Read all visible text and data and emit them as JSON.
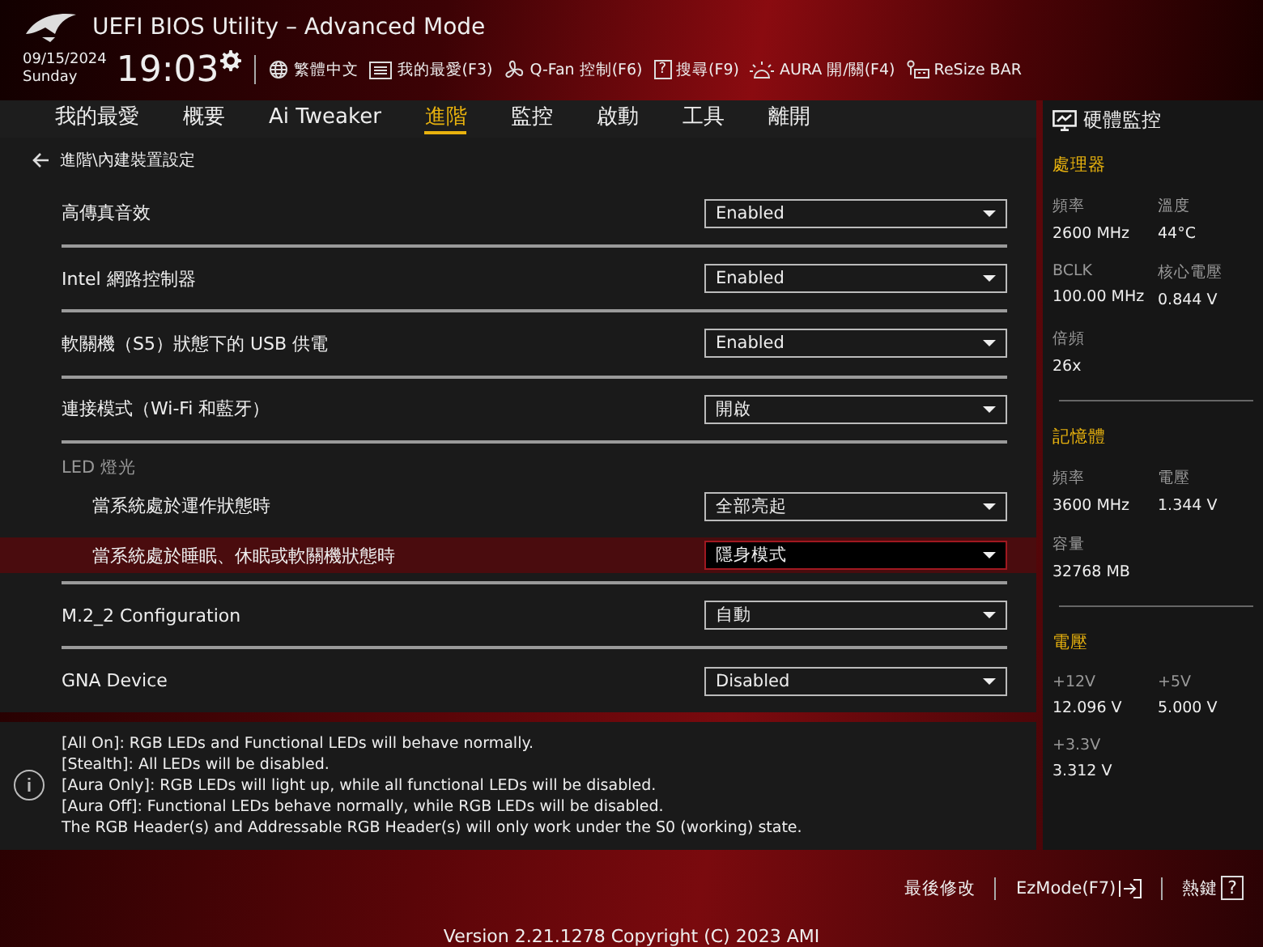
{
  "header": {
    "title": "UEFI BIOS Utility – Advanced Mode",
    "date": "09/15/2024",
    "day": "Sunday",
    "time": "19:03",
    "toolbar": [
      {
        "kind": "language",
        "label": "繁體中文"
      },
      {
        "kind": "favorites",
        "label": "我的最愛(F3)"
      },
      {
        "kind": "fan",
        "label": "Q-Fan 控制(F6)"
      },
      {
        "kind": "search",
        "label": "搜尋(F9)",
        "glyph": "?"
      },
      {
        "kind": "aura",
        "label": "AURA 開/關(F4)"
      },
      {
        "kind": "resize",
        "label": "ReSize BAR"
      }
    ]
  },
  "tabs": [
    {
      "label": "我的最愛",
      "selected": false
    },
    {
      "label": "概要",
      "selected": false
    },
    {
      "label": "Ai Tweaker",
      "selected": false
    },
    {
      "label": "進階",
      "selected": true
    },
    {
      "label": "監控",
      "selected": false
    },
    {
      "label": "啟動",
      "selected": false
    },
    {
      "label": "工具",
      "selected": false
    },
    {
      "label": "離開",
      "selected": false
    }
  ],
  "breadcrumb": "進階\\內建裝置設定",
  "settings": [
    {
      "kind": "setting",
      "label": "高傳真音效",
      "value": "Enabled",
      "selected": false
    },
    {
      "kind": "setting",
      "label": "Intel 網路控制器",
      "value": "Enabled",
      "selected": false
    },
    {
      "kind": "setting",
      "label": "軟關機（S5）狀態下的 USB 供電",
      "value": "Enabled",
      "selected": false
    },
    {
      "kind": "setting",
      "label": "連接模式（Wi-Fi 和藍牙）",
      "value": "開啟",
      "selected": false
    },
    {
      "kind": "group",
      "label": "LED 燈光",
      "children": [
        {
          "label": "當系統處於運作狀態時",
          "value": "全部亮起",
          "selected": false
        },
        {
          "label": "當系統處於睡眠、休眠或軟關機狀態時",
          "value": "隱身模式",
          "selected": true
        }
      ]
    },
    {
      "kind": "setting",
      "label": "M.2_2 Configuration",
      "value": "自動",
      "selected": false
    },
    {
      "kind": "setting",
      "label": "GNA Device",
      "value": "Disabled",
      "selected": false
    }
  ],
  "help": [
    "[All On]: RGB LEDs and Functional LEDs will behave normally.",
    "[Stealth]: All LEDs will be disabled.",
    "[Aura Only]: RGB LEDs will light up, while all functional LEDs will be disabled.",
    "[Aura Off]: Functional LEDs behave normally, while RGB LEDs will be disabled.",
    "The RGB Header(s) and Addressable RGB Header(s) will only work under the S0 (working) state."
  ],
  "monitor": {
    "title": "硬體監控",
    "sections": [
      {
        "title": "處理器",
        "fields": [
          {
            "label": "頻率",
            "value": "2600 MHz"
          },
          {
            "label": "溫度",
            "value": "44°C"
          },
          {
            "label": "BCLK",
            "value": "100.00 MHz"
          },
          {
            "label": "核心電壓",
            "value": "0.844 V"
          },
          {
            "label": "倍頻",
            "value": "26x"
          }
        ]
      },
      {
        "title": "記憶體",
        "fields": [
          {
            "label": "頻率",
            "value": "3600 MHz"
          },
          {
            "label": "電壓",
            "value": "1.344 V"
          },
          {
            "label": "容量",
            "value": "32768 MB"
          }
        ]
      },
      {
        "title": "電壓",
        "fields": [
          {
            "label": "+12V",
            "value": "12.096 V"
          },
          {
            "label": "+5V",
            "value": "5.000 V"
          },
          {
            "label": "+3.3V",
            "value": "3.312 V"
          }
        ]
      }
    ]
  },
  "footer": {
    "buttons": [
      {
        "kind": "plain",
        "label": "最後修改"
      },
      {
        "kind": "ezmode",
        "label": "EzMode(F7)"
      },
      {
        "kind": "hotkey",
        "label": "熱鍵",
        "glyph": "?"
      }
    ],
    "version": "Version 2.21.1278 Copyright (C) 2023 AMI"
  }
}
